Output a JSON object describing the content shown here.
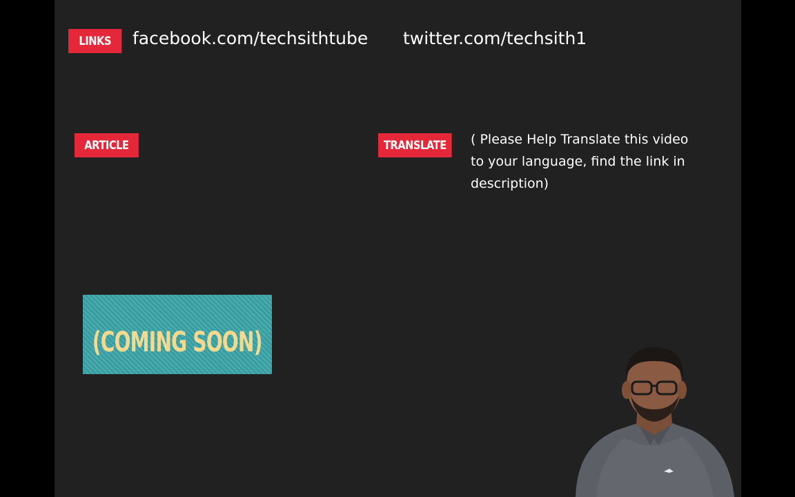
{
  "links": {
    "label": "LINKS",
    "facebook": "facebook.com/techsithtube",
    "twitter": "twitter.com/techsith1"
  },
  "article": {
    "label": "ARTICLE",
    "placeholder_text": "(COMING SOON)"
  },
  "translate": {
    "label": "TRANSLATE",
    "note": "( Please Help Translate this video to your language, find the link in description)"
  },
  "colors": {
    "label_bg": "#e4283a",
    "slide_bg": "#212121",
    "coming_soon_bg": "#3aa3a6",
    "coming_soon_text": "#f4d98f"
  },
  "presenter": {
    "icon": "presenter-video-feed"
  }
}
